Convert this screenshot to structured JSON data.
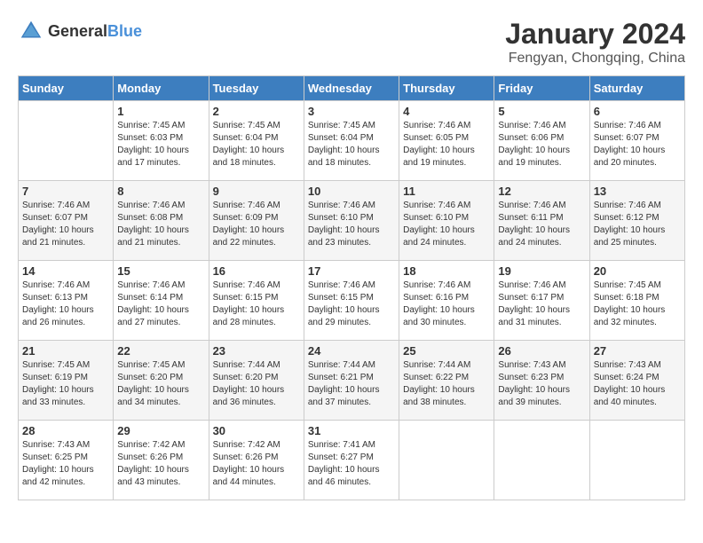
{
  "header": {
    "logo_general": "General",
    "logo_blue": "Blue",
    "month_year": "January 2024",
    "location": "Fengyan, Chongqing, China"
  },
  "days_of_week": [
    "Sunday",
    "Monday",
    "Tuesday",
    "Wednesday",
    "Thursday",
    "Friday",
    "Saturday"
  ],
  "weeks": [
    [
      {
        "day": "",
        "sunrise": "",
        "sunset": "",
        "daylight": ""
      },
      {
        "day": "1",
        "sunrise": "Sunrise: 7:45 AM",
        "sunset": "Sunset: 6:03 PM",
        "daylight": "Daylight: 10 hours and 17 minutes."
      },
      {
        "day": "2",
        "sunrise": "Sunrise: 7:45 AM",
        "sunset": "Sunset: 6:04 PM",
        "daylight": "Daylight: 10 hours and 18 minutes."
      },
      {
        "day": "3",
        "sunrise": "Sunrise: 7:45 AM",
        "sunset": "Sunset: 6:04 PM",
        "daylight": "Daylight: 10 hours and 18 minutes."
      },
      {
        "day": "4",
        "sunrise": "Sunrise: 7:46 AM",
        "sunset": "Sunset: 6:05 PM",
        "daylight": "Daylight: 10 hours and 19 minutes."
      },
      {
        "day": "5",
        "sunrise": "Sunrise: 7:46 AM",
        "sunset": "Sunset: 6:06 PM",
        "daylight": "Daylight: 10 hours and 19 minutes."
      },
      {
        "day": "6",
        "sunrise": "Sunrise: 7:46 AM",
        "sunset": "Sunset: 6:07 PM",
        "daylight": "Daylight: 10 hours and 20 minutes."
      }
    ],
    [
      {
        "day": "7",
        "sunrise": "Sunrise: 7:46 AM",
        "sunset": "Sunset: 6:07 PM",
        "daylight": "Daylight: 10 hours and 21 minutes."
      },
      {
        "day": "8",
        "sunrise": "Sunrise: 7:46 AM",
        "sunset": "Sunset: 6:08 PM",
        "daylight": "Daylight: 10 hours and 21 minutes."
      },
      {
        "day": "9",
        "sunrise": "Sunrise: 7:46 AM",
        "sunset": "Sunset: 6:09 PM",
        "daylight": "Daylight: 10 hours and 22 minutes."
      },
      {
        "day": "10",
        "sunrise": "Sunrise: 7:46 AM",
        "sunset": "Sunset: 6:10 PM",
        "daylight": "Daylight: 10 hours and 23 minutes."
      },
      {
        "day": "11",
        "sunrise": "Sunrise: 7:46 AM",
        "sunset": "Sunset: 6:10 PM",
        "daylight": "Daylight: 10 hours and 24 minutes."
      },
      {
        "day": "12",
        "sunrise": "Sunrise: 7:46 AM",
        "sunset": "Sunset: 6:11 PM",
        "daylight": "Daylight: 10 hours and 24 minutes."
      },
      {
        "day": "13",
        "sunrise": "Sunrise: 7:46 AM",
        "sunset": "Sunset: 6:12 PM",
        "daylight": "Daylight: 10 hours and 25 minutes."
      }
    ],
    [
      {
        "day": "14",
        "sunrise": "Sunrise: 7:46 AM",
        "sunset": "Sunset: 6:13 PM",
        "daylight": "Daylight: 10 hours and 26 minutes."
      },
      {
        "day": "15",
        "sunrise": "Sunrise: 7:46 AM",
        "sunset": "Sunset: 6:14 PM",
        "daylight": "Daylight: 10 hours and 27 minutes."
      },
      {
        "day": "16",
        "sunrise": "Sunrise: 7:46 AM",
        "sunset": "Sunset: 6:15 PM",
        "daylight": "Daylight: 10 hours and 28 minutes."
      },
      {
        "day": "17",
        "sunrise": "Sunrise: 7:46 AM",
        "sunset": "Sunset: 6:15 PM",
        "daylight": "Daylight: 10 hours and 29 minutes."
      },
      {
        "day": "18",
        "sunrise": "Sunrise: 7:46 AM",
        "sunset": "Sunset: 6:16 PM",
        "daylight": "Daylight: 10 hours and 30 minutes."
      },
      {
        "day": "19",
        "sunrise": "Sunrise: 7:46 AM",
        "sunset": "Sunset: 6:17 PM",
        "daylight": "Daylight: 10 hours and 31 minutes."
      },
      {
        "day": "20",
        "sunrise": "Sunrise: 7:45 AM",
        "sunset": "Sunset: 6:18 PM",
        "daylight": "Daylight: 10 hours and 32 minutes."
      }
    ],
    [
      {
        "day": "21",
        "sunrise": "Sunrise: 7:45 AM",
        "sunset": "Sunset: 6:19 PM",
        "daylight": "Daylight: 10 hours and 33 minutes."
      },
      {
        "day": "22",
        "sunrise": "Sunrise: 7:45 AM",
        "sunset": "Sunset: 6:20 PM",
        "daylight": "Daylight: 10 hours and 34 minutes."
      },
      {
        "day": "23",
        "sunrise": "Sunrise: 7:44 AM",
        "sunset": "Sunset: 6:20 PM",
        "daylight": "Daylight: 10 hours and 36 minutes."
      },
      {
        "day": "24",
        "sunrise": "Sunrise: 7:44 AM",
        "sunset": "Sunset: 6:21 PM",
        "daylight": "Daylight: 10 hours and 37 minutes."
      },
      {
        "day": "25",
        "sunrise": "Sunrise: 7:44 AM",
        "sunset": "Sunset: 6:22 PM",
        "daylight": "Daylight: 10 hours and 38 minutes."
      },
      {
        "day": "26",
        "sunrise": "Sunrise: 7:43 AM",
        "sunset": "Sunset: 6:23 PM",
        "daylight": "Daylight: 10 hours and 39 minutes."
      },
      {
        "day": "27",
        "sunrise": "Sunrise: 7:43 AM",
        "sunset": "Sunset: 6:24 PM",
        "daylight": "Daylight: 10 hours and 40 minutes."
      }
    ],
    [
      {
        "day": "28",
        "sunrise": "Sunrise: 7:43 AM",
        "sunset": "Sunset: 6:25 PM",
        "daylight": "Daylight: 10 hours and 42 minutes."
      },
      {
        "day": "29",
        "sunrise": "Sunrise: 7:42 AM",
        "sunset": "Sunset: 6:26 PM",
        "daylight": "Daylight: 10 hours and 43 minutes."
      },
      {
        "day": "30",
        "sunrise": "Sunrise: 7:42 AM",
        "sunset": "Sunset: 6:26 PM",
        "daylight": "Daylight: 10 hours and 44 minutes."
      },
      {
        "day": "31",
        "sunrise": "Sunrise: 7:41 AM",
        "sunset": "Sunset: 6:27 PM",
        "daylight": "Daylight: 10 hours and 46 minutes."
      },
      {
        "day": "",
        "sunrise": "",
        "sunset": "",
        "daylight": ""
      },
      {
        "day": "",
        "sunrise": "",
        "sunset": "",
        "daylight": ""
      },
      {
        "day": "",
        "sunrise": "",
        "sunset": "",
        "daylight": ""
      }
    ]
  ]
}
